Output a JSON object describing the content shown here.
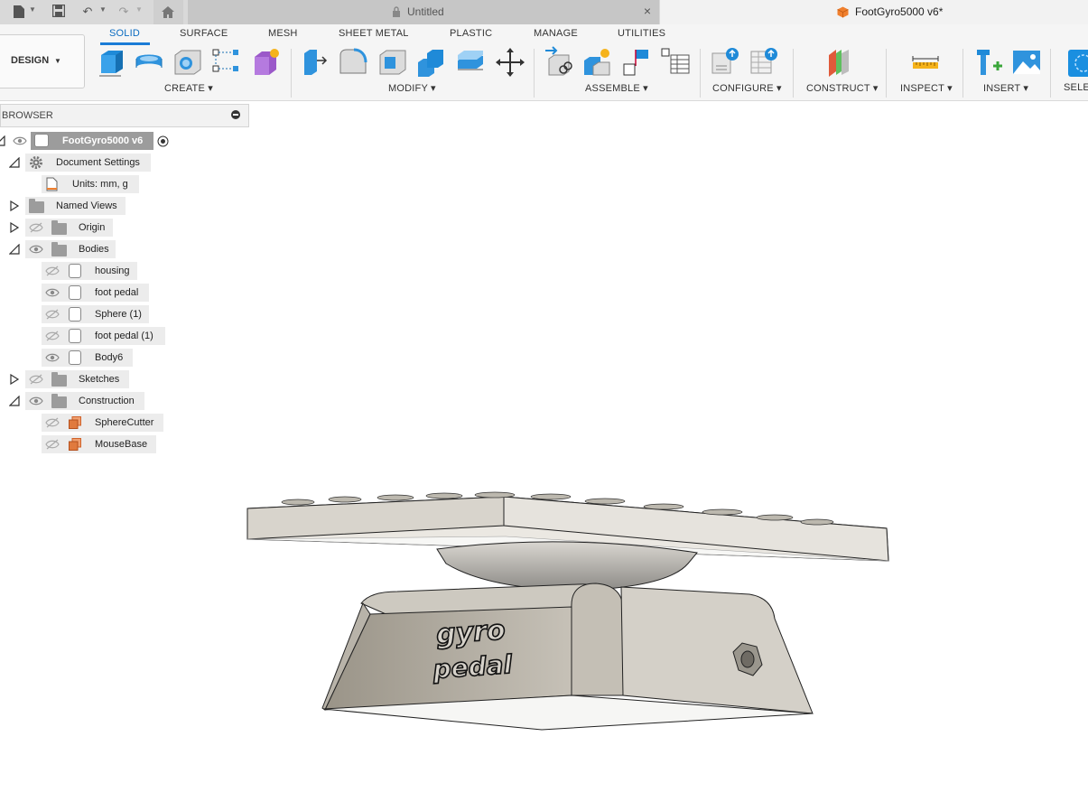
{
  "window": {
    "untitled_tab": "Untitled",
    "active_tab": "FootGyro5000 v6*",
    "close_icon": "×"
  },
  "toolbar": {
    "workspace": "DESIGN",
    "tabs": [
      "SOLID",
      "SURFACE",
      "MESH",
      "SHEET METAL",
      "PLASTIC",
      "MANAGE",
      "UTILITIES"
    ],
    "active_tab": "SOLID",
    "groups": [
      "CREATE ▾",
      "MODIFY ▾",
      "ASSEMBLE ▾",
      "CONFIGURE ▾",
      "CONSTRUCT ▾",
      "INSPECT ▾",
      "INSERT ▾",
      "SELE"
    ],
    "accent": "#1a7cd6"
  },
  "browser": {
    "title": "BROWSER",
    "root": "FootGyro5000 v6",
    "items": [
      {
        "label": "Document Settings",
        "icon": "gear-icon"
      },
      {
        "label": "Units: mm, g",
        "icon": "document-icon"
      },
      {
        "label": "Named Views",
        "icon": "folder-icon"
      },
      {
        "label": "Origin",
        "icon": "folder-icon"
      },
      {
        "label": "Bodies",
        "icon": "folder-icon"
      },
      {
        "label": "housing",
        "icon": "body-icon"
      },
      {
        "label": "foot pedal",
        "icon": "body-icon"
      },
      {
        "label": "Sphere (1)",
        "icon": "body-icon"
      },
      {
        "label": "foot pedal (1)",
        "icon": "body-icon"
      },
      {
        "label": "Body6",
        "icon": "body-icon"
      },
      {
        "label": "Sketches",
        "icon": "folder-icon"
      },
      {
        "label": "Construction",
        "icon": "folder-icon"
      },
      {
        "label": "SphereCutter",
        "icon": "construction-plane-icon"
      },
      {
        "label": "MouseBase",
        "icon": "construction-plane-icon"
      }
    ]
  },
  "model": {
    "engraving_line1": "gyro",
    "engraving_line2": "pedal"
  }
}
